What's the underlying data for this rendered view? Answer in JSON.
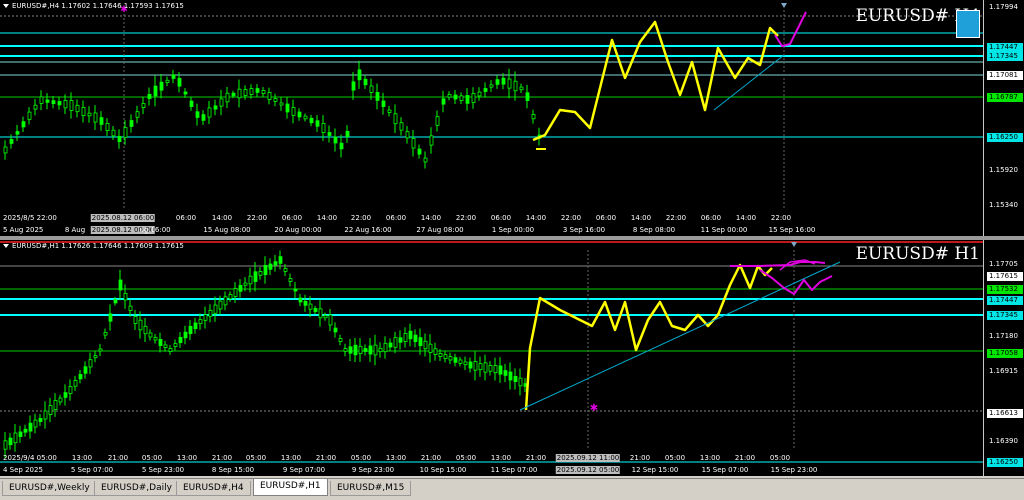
{
  "colors": {
    "background": "#000000",
    "candle": "#00ff00",
    "zigzag": "#ffff00",
    "forecast": "#e000e0",
    "hline_cyan": "#00ffff",
    "hline_green": "#00cc00",
    "trend": "#00aacc",
    "red_line": "#ff2020"
  },
  "chart_h4": {
    "header": "EURUSD#,H4  1.17602 1.17646 1.17593 1.17615",
    "symbol_label": "EURUSD# H4",
    "price_labels": [
      {
        "text": "1.17994",
        "style": "plain"
      },
      {
        "text": "1.17447",
        "style": "cyan"
      },
      {
        "text": "1.17345",
        "style": "cyan"
      },
      {
        "text": "1.17081",
        "style": "white"
      },
      {
        "text": "1.16787",
        "style": "green"
      },
      {
        "text": "1.16250",
        "style": "cyan"
      },
      {
        "text": "1.15920",
        "style": "plain"
      },
      {
        "text": "1.15340",
        "style": "plain"
      }
    ],
    "time_labels": [
      {
        "text": "2025/8/5 22:00",
        "style": "plain"
      },
      {
        "text": "2025.08.12 06:00",
        "style": "hl"
      },
      {
        "text": "06:00",
        "style": "plain"
      },
      {
        "text": "14:00",
        "style": "plain"
      },
      {
        "text": "22:00",
        "style": "plain"
      },
      {
        "text": "06:00",
        "style": "plain"
      },
      {
        "text": "14:00",
        "style": "plain"
      },
      {
        "text": "22:00",
        "style": "plain"
      },
      {
        "text": "06:00",
        "style": "plain"
      },
      {
        "text": "14:00",
        "style": "plain"
      },
      {
        "text": "22:00",
        "style": "plain"
      },
      {
        "text": "06:00",
        "style": "plain"
      },
      {
        "text": "14:00",
        "style": "plain"
      },
      {
        "text": "22:00",
        "style": "plain"
      },
      {
        "text": "06:00",
        "style": "plain"
      },
      {
        "text": "14:00",
        "style": "plain"
      },
      {
        "text": "22:00",
        "style": "plain"
      },
      {
        "text": "06:00",
        "style": "plain"
      },
      {
        "text": "14:00",
        "style": "plain"
      },
      {
        "text": "22:00",
        "style": "plain"
      }
    ],
    "time_labels_row2": [
      {
        "text": "5 Aug 2025",
        "style": "plain"
      },
      {
        "text": "8 Aug",
        "style": "plain"
      },
      {
        "text": "2025.08.12 00:00",
        "style": "hl"
      },
      {
        "text": "ug 16:00",
        "style": "plain"
      },
      {
        "text": "15 Aug 08:00",
        "style": "plain"
      },
      {
        "text": "20 Aug 00:00",
        "style": "plain"
      },
      {
        "text": "22 Aug 16:00",
        "style": "plain"
      },
      {
        "text": "27 Aug 08:00",
        "style": "plain"
      },
      {
        "text": "1 Sep 00:00",
        "style": "plain"
      },
      {
        "text": "3 Sep 16:00",
        "style": "plain"
      },
      {
        "text": "8 Sep 08:00",
        "style": "plain"
      },
      {
        "text": "11 Sep 00:00",
        "style": "plain"
      },
      {
        "text": "15 Sep 16:00",
        "style": "plain"
      }
    ]
  },
  "chart_h1": {
    "header": "EURUSD#,H1  1.17626 1.17646 1.17609 1.17615",
    "symbol_label": "EURUSD# H1",
    "price_labels": [
      {
        "text": "1.17705",
        "style": "plain"
      },
      {
        "text": "1.17615",
        "style": "white"
      },
      {
        "text": "1.17532",
        "style": "green"
      },
      {
        "text": "1.17447",
        "style": "cyan"
      },
      {
        "text": "1.17345",
        "style": "cyan"
      },
      {
        "text": "1.17180",
        "style": "plain"
      },
      {
        "text": "1.17058",
        "style": "green"
      },
      {
        "text": "1.16915",
        "style": "plain"
      },
      {
        "text": "1.16613",
        "style": "white"
      },
      {
        "text": "1.16390",
        "style": "plain"
      },
      {
        "text": "1.16250",
        "style": "cyan"
      }
    ],
    "time_labels": [
      {
        "text": "2025/9/4 05:00",
        "style": "plain"
      },
      {
        "text": "13:00",
        "style": "plain"
      },
      {
        "text": "21:00",
        "style": "plain"
      },
      {
        "text": "05:00",
        "style": "plain"
      },
      {
        "text": "13:00",
        "style": "plain"
      },
      {
        "text": "21:00",
        "style": "plain"
      },
      {
        "text": "05:00",
        "style": "plain"
      },
      {
        "text": "13:00",
        "style": "plain"
      },
      {
        "text": "21:00",
        "style": "plain"
      },
      {
        "text": "05:00",
        "style": "plain"
      },
      {
        "text": "13:00",
        "style": "plain"
      },
      {
        "text": "21:00",
        "style": "plain"
      },
      {
        "text": "05:00",
        "style": "plain"
      },
      {
        "text": "13:00",
        "style": "plain"
      },
      {
        "text": "21:00",
        "style": "plain"
      },
      {
        "text": "2025.09.12 11:00",
        "style": "hl"
      },
      {
        "text": "21:00",
        "style": "plain"
      },
      {
        "text": "05:00",
        "style": "plain"
      },
      {
        "text": "13:00",
        "style": "plain"
      },
      {
        "text": "21:00",
        "style": "plain"
      },
      {
        "text": "05:00",
        "style": "plain"
      }
    ],
    "time_labels_row2": [
      {
        "text": "4 Sep 2025",
        "style": "plain"
      },
      {
        "text": "5 Sep 07:00",
        "style": "plain"
      },
      {
        "text": "5 Sep 23:00",
        "style": "plain"
      },
      {
        "text": "8 Sep 15:00",
        "style": "plain"
      },
      {
        "text": "9 Sep 07:00",
        "style": "plain"
      },
      {
        "text": "9 Sep 23:00",
        "style": "plain"
      },
      {
        "text": "10 Sep 15:00",
        "style": "plain"
      },
      {
        "text": "11 Sep 07:00",
        "style": "plain"
      },
      {
        "text": "2025.09.12 05:00",
        "style": "hl"
      },
      {
        "text": "12 Sep 15:00",
        "style": "plain"
      },
      {
        "text": "15 Sep 07:00",
        "style": "plain"
      },
      {
        "text": "15 Sep 23:00",
        "style": "plain"
      }
    ]
  },
  "tabs": [
    {
      "label": "EURUSD#,Weekly",
      "active": false
    },
    {
      "label": "EURUSD#,Daily",
      "active": false
    },
    {
      "label": "EURUSD#,H4",
      "active": false
    },
    {
      "label": "EURUSD#,H1",
      "active": true
    },
    {
      "label": "EURUSD#,M15",
      "active": false
    }
  ]
}
